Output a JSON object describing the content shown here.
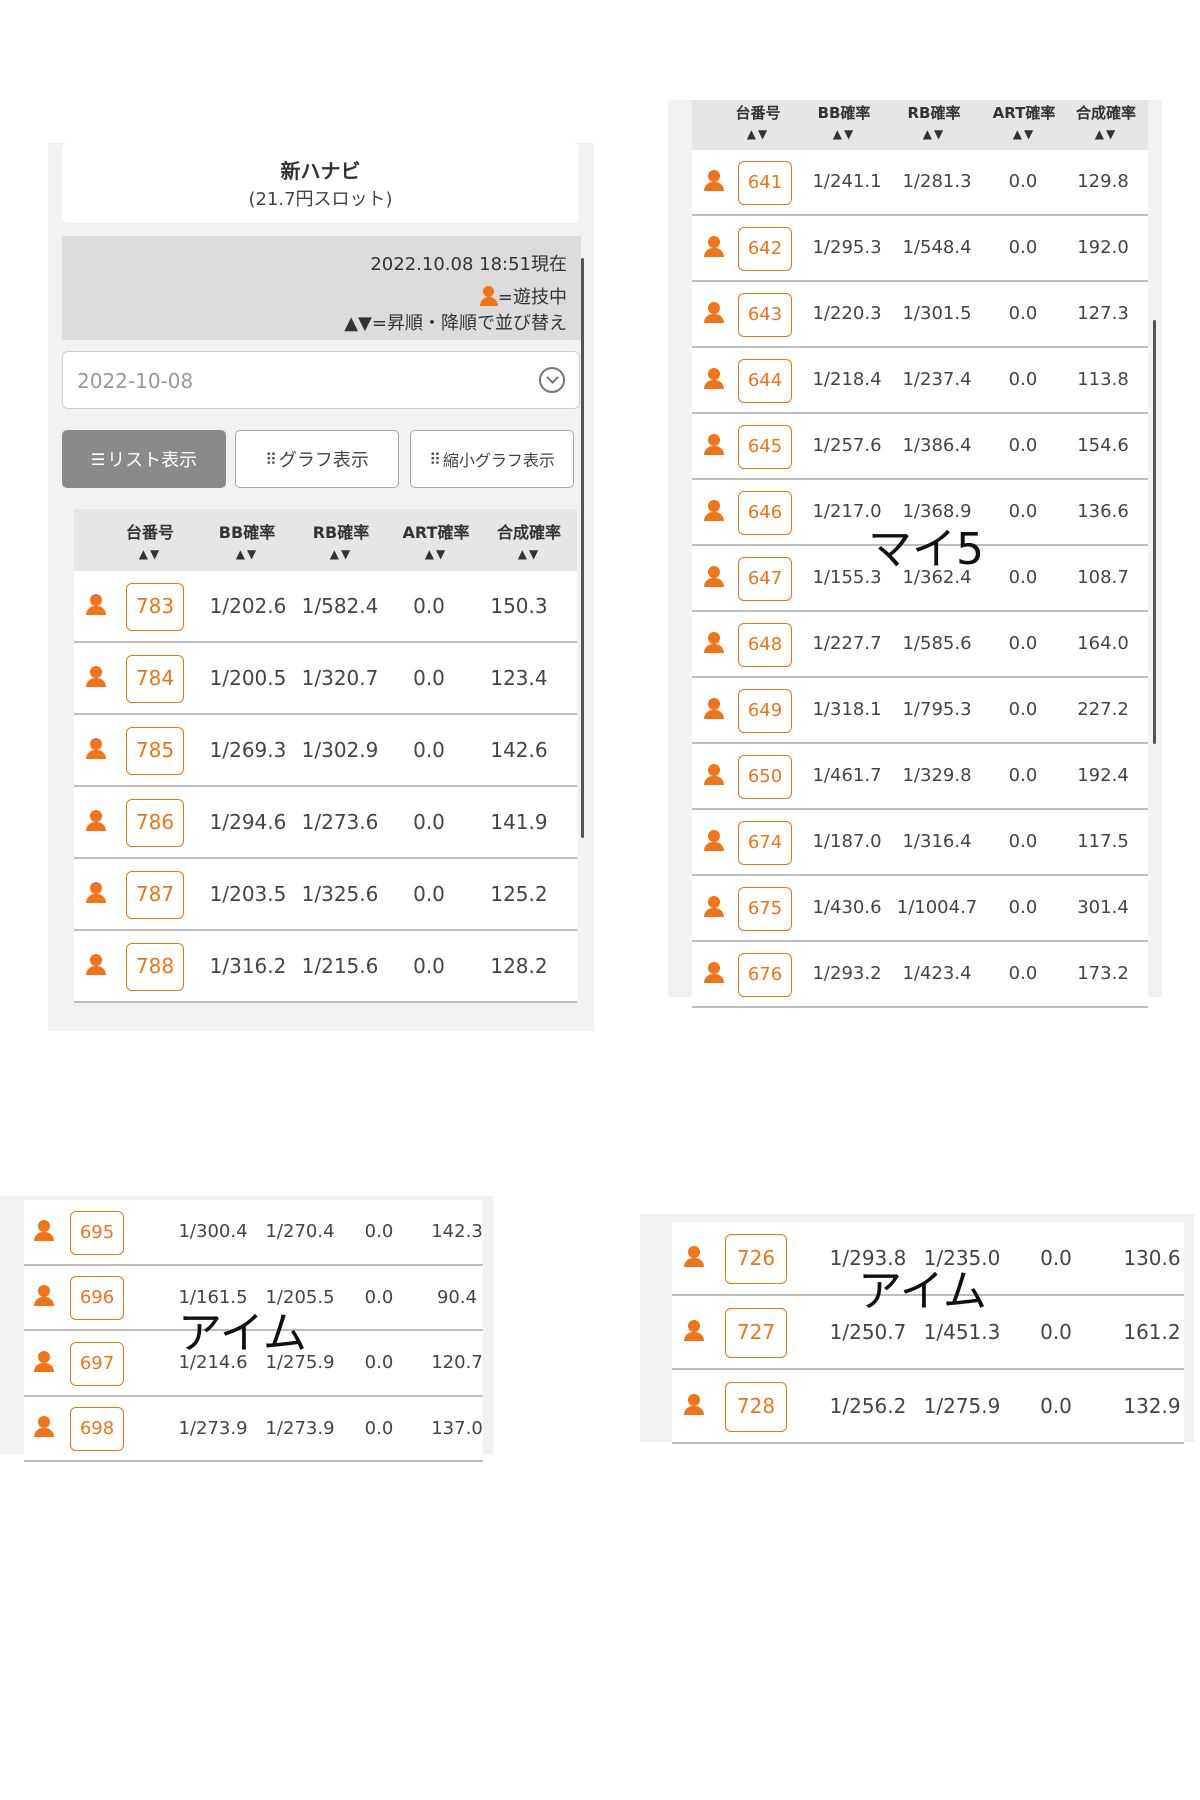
{
  "panel_a": {
    "title": "新ハナビ",
    "subtitle": "(21.7円スロット)",
    "timestamp": "2022.10.08 18:51現在",
    "legend_playing": "=遊技中",
    "legend_sort": "▲▼=昇順・降順で並び替え",
    "date_value": "2022-10-08",
    "buttons": {
      "list": "リスト表示",
      "graph": "グラフ表示",
      "mini_graph": "縮小グラフ表示"
    }
  },
  "headers": {
    "machine": "台番号",
    "bb": "BB確率",
    "rb": "RB確率",
    "art": "ART確率",
    "combined": "合成確率",
    "sort_arrows": "▲▼"
  },
  "table_a": [
    {
      "no": "783",
      "bb": "1/202.6",
      "rb": "1/582.4",
      "art": "0.0",
      "combined": "150.3"
    },
    {
      "no": "784",
      "bb": "1/200.5",
      "rb": "1/320.7",
      "art": "0.0",
      "combined": "123.4"
    },
    {
      "no": "785",
      "bb": "1/269.3",
      "rb": "1/302.9",
      "art": "0.0",
      "combined": "142.6"
    },
    {
      "no": "786",
      "bb": "1/294.6",
      "rb": "1/273.6",
      "art": "0.0",
      "combined": "141.9"
    },
    {
      "no": "787",
      "bb": "1/203.5",
      "rb": "1/325.6",
      "art": "0.0",
      "combined": "125.2"
    },
    {
      "no": "788",
      "bb": "1/316.2",
      "rb": "1/215.6",
      "art": "0.0",
      "combined": "128.2"
    }
  ],
  "table_b": [
    {
      "no": "641",
      "bb": "1/241.1",
      "rb": "1/281.3",
      "art": "0.0",
      "combined": "129.8"
    },
    {
      "no": "642",
      "bb": "1/295.3",
      "rb": "1/548.4",
      "art": "0.0",
      "combined": "192.0"
    },
    {
      "no": "643",
      "bb": "1/220.3",
      "rb": "1/301.5",
      "art": "0.0",
      "combined": "127.3"
    },
    {
      "no": "644",
      "bb": "1/218.4",
      "rb": "1/237.4",
      "art": "0.0",
      "combined": "113.8"
    },
    {
      "no": "645",
      "bb": "1/257.6",
      "rb": "1/386.4",
      "art": "0.0",
      "combined": "154.6"
    },
    {
      "no": "646",
      "bb": "1/217.0",
      "rb": "1/368.9",
      "art": "0.0",
      "combined": "136.6"
    },
    {
      "no": "647",
      "bb": "1/155.3",
      "rb": "1/362.4",
      "art": "0.0",
      "combined": "108.7"
    },
    {
      "no": "648",
      "bb": "1/227.7",
      "rb": "1/585.6",
      "art": "0.0",
      "combined": "164.0"
    },
    {
      "no": "649",
      "bb": "1/318.1",
      "rb": "1/795.3",
      "art": "0.0",
      "combined": "227.2"
    },
    {
      "no": "650",
      "bb": "1/461.7",
      "rb": "1/329.8",
      "art": "0.0",
      "combined": "192.4"
    },
    {
      "no": "674",
      "bb": "1/187.0",
      "rb": "1/316.4",
      "art": "0.0",
      "combined": "117.5"
    },
    {
      "no": "675",
      "bb": "1/430.6",
      "rb": "1/1004.7",
      "art": "0.0",
      "combined": "301.4"
    },
    {
      "no": "676",
      "bb": "1/293.2",
      "rb": "1/423.4",
      "art": "0.0",
      "combined": "173.2"
    }
  ],
  "table_c": [
    {
      "no": "695",
      "bb": "1/300.4",
      "rb": "1/270.4",
      "art": "0.0",
      "combined": "142.3"
    },
    {
      "no": "696",
      "bb": "1/161.5",
      "rb": "1/205.5",
      "art": "0.0",
      "combined": "90.4"
    },
    {
      "no": "697",
      "bb": "1/214.6",
      "rb": "1/275.9",
      "art": "0.0",
      "combined": "120.7"
    },
    {
      "no": "698",
      "bb": "1/273.9",
      "rb": "1/273.9",
      "art": "0.0",
      "combined": "137.0"
    }
  ],
  "table_d": [
    {
      "no": "726",
      "bb": "1/293.8",
      "rb": "1/235.0",
      "art": "0.0",
      "combined": "130.6"
    },
    {
      "no": "727",
      "bb": "1/250.7",
      "rb": "1/451.3",
      "art": "0.0",
      "combined": "161.2"
    },
    {
      "no": "728",
      "bb": "1/256.2",
      "rb": "1/275.9",
      "art": "0.0",
      "combined": "132.9"
    }
  ],
  "annotations": {
    "b": "マイ5",
    "c": "アイム",
    "d": "アイム"
  },
  "colors": {
    "accent": "#f07418",
    "header_bg": "#e6e6e6",
    "info_bg": "#dcdcdc",
    "active_button": "#8a8a8a"
  },
  "icons": [
    "person-icon",
    "chevron-down-icon",
    "list-icon",
    "grid-icon"
  ]
}
